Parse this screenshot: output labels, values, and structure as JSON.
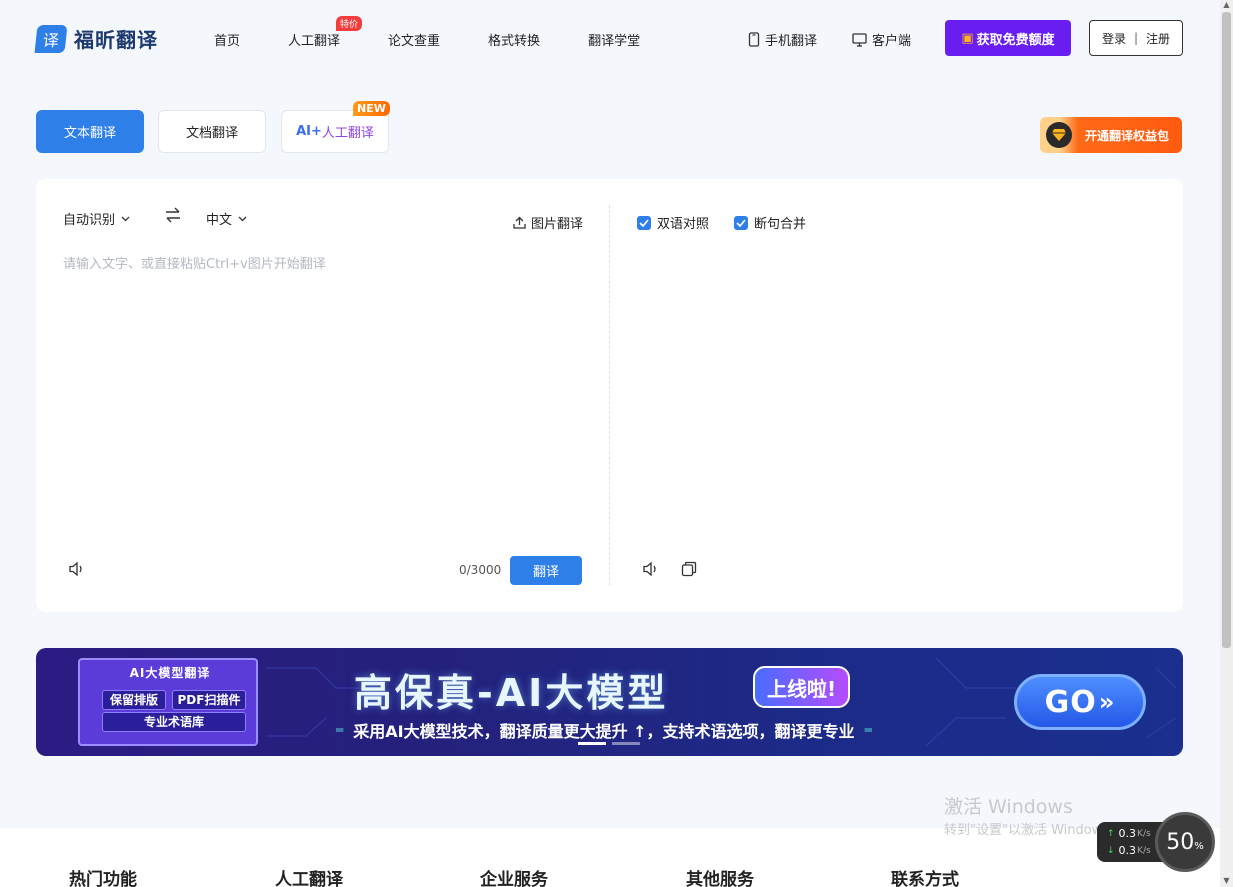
{
  "header": {
    "logo_icon": "译",
    "logo_text": "福昕翻译",
    "nav": [
      {
        "label": "首页"
      },
      {
        "label": "人工翻译",
        "badge": "特价"
      },
      {
        "label": "论文查重"
      },
      {
        "label": "格式转换"
      },
      {
        "label": "翻译学堂"
      }
    ],
    "mobile_label": "手机翻译",
    "client_label": "客户端",
    "free_quota_label": "获取免费额度",
    "login_label": "登录",
    "register_label": "注册"
  },
  "modes": {
    "text": "文本翻译",
    "doc": "文档翻译",
    "ai_prefix": "AI+",
    "ai_suffix": "人工翻译",
    "new_badge": "NEW"
  },
  "benefit_label": "开通翻译权益包",
  "translator": {
    "source_lang": "自动识别",
    "target_lang": "中文",
    "image_translate": "图片翻译",
    "placeholder": "请输入文字、或直接粘贴Ctrl+v图片开始翻译",
    "counter": "0/3000",
    "translate_button": "翻译",
    "bilingual_label": "双语对照",
    "merge_label": "断句合并",
    "bilingual_checked": true,
    "merge_checked": true
  },
  "banner": {
    "box_title": "AI大模型翻译",
    "pill1": "保留排版",
    "pill2": "PDF扫描件",
    "pill3": "专业术语库",
    "title": "高保真-AI大模型",
    "online": "上线啦!",
    "subtitle": "采用AI大模型技术，翻译质量更大提升 ↑，支持术语选项，翻译更专业",
    "go": "GO",
    "active_slide": 1,
    "slides": 2
  },
  "footer": {
    "cols": [
      "热门功能",
      "人工翻译",
      "企业服务",
      "其他服务",
      "联系方式"
    ]
  },
  "watermark": {
    "line1": "激活 Windows",
    "line2": "转到\"设置\"以激活 Windows。"
  },
  "net_widget": {
    "up": "0.3",
    "down": "0.3",
    "unit": "K/s",
    "percent": "50",
    "percent_sign": "%"
  },
  "colors": {
    "primary": "#2f7fe8",
    "purple_cta": "#6a1df0",
    "hot_badge": "#f23d3d",
    "new_badge": "#ff7a00"
  }
}
